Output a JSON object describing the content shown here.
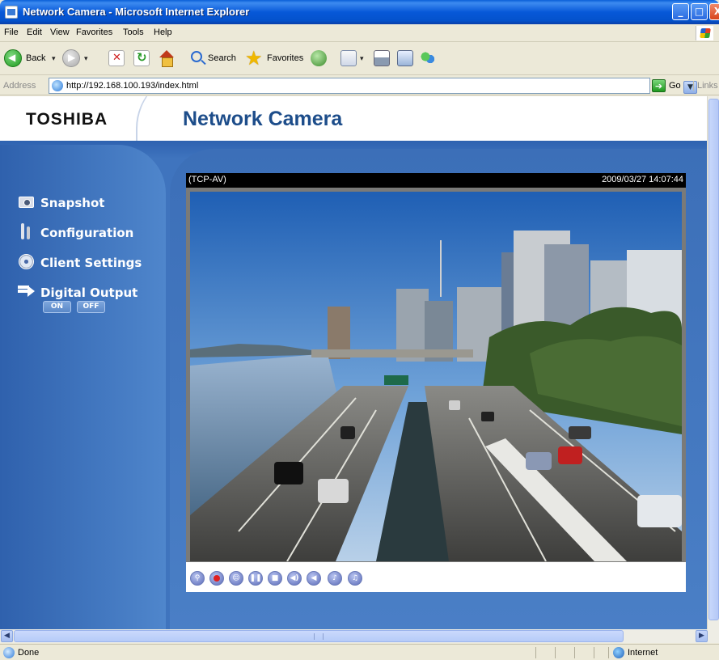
{
  "window": {
    "title": "Network Camera - Microsoft Internet Explorer",
    "controls": {
      "minimize": "_",
      "maximize": "□",
      "close": "X"
    }
  },
  "menu": [
    {
      "label": "File"
    },
    {
      "label": "Edit"
    },
    {
      "label": "View"
    },
    {
      "label": "Favorites"
    },
    {
      "label": "Tools"
    },
    {
      "label": "Help"
    }
  ],
  "toolbar": {
    "back_label": "Back",
    "search_label": "Search",
    "favorites_label": "Favorites",
    "icons": [
      "back-icon",
      "forward-icon",
      "stop-icon",
      "refresh-icon",
      "home-icon",
      "search-icon",
      "favorites-icon",
      "media-icon",
      "mail-icon",
      "print-icon",
      "edit-icon",
      "messenger-icon"
    ]
  },
  "address_bar": {
    "label": "Address",
    "url": "http://192.168.100.193/index.html",
    "go_label": "Go",
    "links_label": "Links"
  },
  "page": {
    "brand": "TOSHIBA",
    "title": "Network Camera",
    "sidebar": {
      "snapshot": "Snapshot",
      "configuration": "Configuration",
      "client_settings": "Client Settings",
      "digital_output": "Digital Output",
      "on_label": "ON",
      "off_label": "OFF"
    },
    "video": {
      "mode": "(TCP-AV)",
      "timestamp": "2009/03/27 14:07:44"
    },
    "controls": [
      "zoom-icon",
      "record-icon",
      "snapshot-user-icon",
      "pause-icon",
      "stop-icon",
      "speaker-icon",
      "mute-icon",
      "talk-icon",
      "talk-mute-icon"
    ]
  },
  "status_bar": {
    "text": "Done",
    "zone": "Internet"
  },
  "colors": {
    "title_bar": "#0758d8",
    "page_background": "#3f74be",
    "header_title": "#1d4d8a"
  }
}
